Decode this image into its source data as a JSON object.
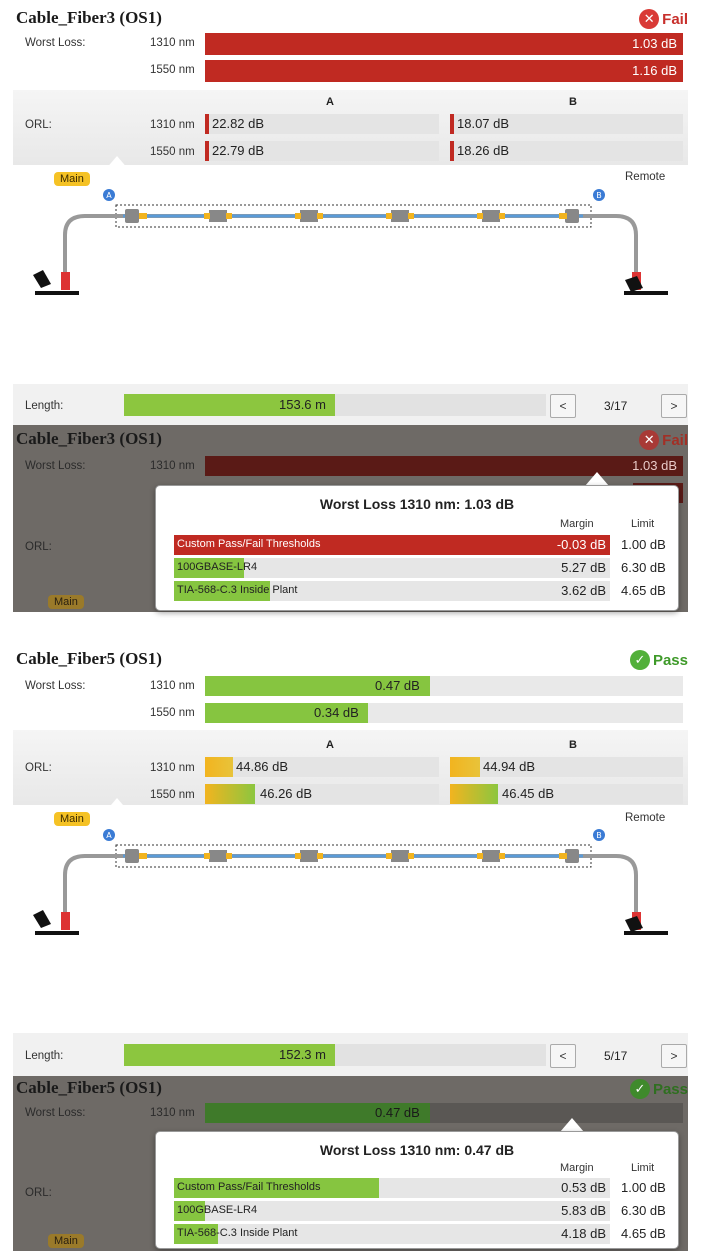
{
  "panels": [
    {
      "title": "Cable_Fiber3 (OS1)",
      "status": "Fail",
      "worst_loss_label": "Worst Loss:",
      "loss": [
        {
          "wl": "1310 nm",
          "value": "1.03 dB",
          "fill": 1.0
        },
        {
          "wl": "1550 nm",
          "value": "1.16 dB",
          "fill": 1.0
        }
      ],
      "orl_label": "ORL:",
      "col_a": "A",
      "col_b": "B",
      "orl": [
        {
          "wl": "1310 nm",
          "a": "22.82 dB",
          "b": "18.07 dB"
        },
        {
          "wl": "1550 nm",
          "a": "22.79 dB",
          "b": "18.26 dB"
        }
      ],
      "main_tag": "Main",
      "remote_tag": "Remote",
      "length_label": "Length:",
      "length_value": "153.6 m",
      "length_fill": 0.5,
      "prev": "<",
      "next": ">",
      "page": "3/17"
    },
    {
      "title": "Cable_Fiber5 (OS1)",
      "status": "Pass",
      "worst_loss_label": "Worst Loss:",
      "loss": [
        {
          "wl": "1310 nm",
          "value": "0.47 dB",
          "fill": 0.47
        },
        {
          "wl": "1550 nm",
          "value": "0.34 dB",
          "fill": 0.34
        }
      ],
      "orl_label": "ORL:",
      "col_a": "A",
      "col_b": "B",
      "orl": [
        {
          "wl": "1310 nm",
          "a": "44.86 dB",
          "b": "44.94 dB"
        },
        {
          "wl": "1550 nm",
          "a": "46.26 dB",
          "b": "46.45 dB"
        }
      ],
      "main_tag": "Main",
      "remote_tag": "Remote",
      "length_label": "Length:",
      "length_value": "152.3 m",
      "length_fill": 0.5,
      "prev": "<",
      "next": ">",
      "page": "5/17"
    }
  ],
  "overlays": [
    {
      "title": "Cable_Fiber3 (OS1)",
      "status": "Fail",
      "worst_loss_label": "Worst Loss:",
      "wl": "1310 nm",
      "value": "1.03 dB",
      "orl_label": "ORL:",
      "main_tag": "Main",
      "popup_title": "Worst Loss 1310 nm: 1.03 dB",
      "margin_head": "Margin",
      "limit_head": "Limit",
      "rows": [
        {
          "name": "Custom Pass/Fail Thresholds",
          "margin": "-0.03 dB",
          "limit": "1.00 dB",
          "state": "fail",
          "fill": 1.0
        },
        {
          "name": "100GBASE-LR4",
          "margin": "5.27 dB",
          "limit": "6.30 dB",
          "state": "pass",
          "fill": 0.16
        },
        {
          "name": "TIA-568-C.3 Inside Plant",
          "margin": "3.62 dB",
          "limit": "4.65 dB",
          "state": "pass",
          "fill": 0.22
        }
      ]
    },
    {
      "title": "Cable_Fiber5 (OS1)",
      "status": "Pass",
      "worst_loss_label": "Worst Loss:",
      "wl": "1310 nm",
      "value": "0.47 dB",
      "orl_label": "ORL:",
      "main_tag": "Main",
      "popup_title": "Worst Loss 1310 nm: 0.47 dB",
      "margin_head": "Margin",
      "limit_head": "Limit",
      "rows": [
        {
          "name": "Custom Pass/Fail Thresholds",
          "margin": "0.53 dB",
          "limit": "1.00 dB",
          "state": "pass",
          "fill": 0.47
        },
        {
          "name": "100GBASE-LR4",
          "margin": "5.83 dB",
          "limit": "6.30 dB",
          "state": "pass",
          "fill": 0.07
        },
        {
          "name": "TIA-568-C.3 Inside Plant",
          "margin": "4.18 dB",
          "limit": "4.65 dB",
          "state": "pass",
          "fill": 0.1
        }
      ]
    }
  ],
  "colors": {
    "fail_red": "#c02a22",
    "pass_green": "#86c540",
    "orl_yellow": "#f2b41f",
    "overlay_bg": "#6e6a66"
  }
}
